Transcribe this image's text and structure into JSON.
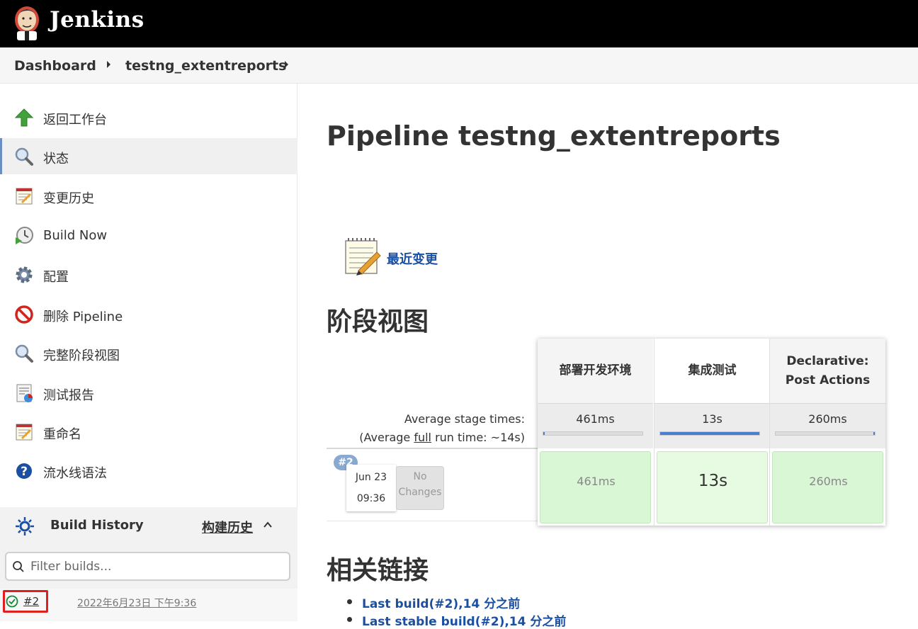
{
  "header": {
    "logo_text": "Jenkins"
  },
  "breadcrumb": {
    "items": [
      "Dashboard",
      "testng_extentreports"
    ]
  },
  "sidebar": {
    "items": [
      {
        "label": "返回工作台",
        "icon": "up-arrow-icon"
      },
      {
        "label": "状态",
        "icon": "search-icon",
        "active": true
      },
      {
        "label": "变更历史",
        "icon": "notepad-icon"
      },
      {
        "label": "Build Now",
        "icon": "clock-play-icon"
      },
      {
        "label": "配置",
        "icon": "gear-icon"
      },
      {
        "label": "删除 Pipeline",
        "icon": "no-entry-icon"
      },
      {
        "label": "完整阶段视图",
        "icon": "search-icon"
      },
      {
        "label": "测试报告",
        "icon": "report-icon"
      },
      {
        "label": "重命名",
        "icon": "notepad-icon"
      },
      {
        "label": "流水线语法",
        "icon": "help-icon"
      }
    ],
    "build_history": {
      "title": "Build History",
      "link": "构建历史",
      "filter_placeholder": "Filter builds...",
      "builds": [
        {
          "number": "#2",
          "date": "2022年6月23日 下午9:36",
          "status": "success"
        }
      ]
    }
  },
  "main": {
    "title": "Pipeline testng_extentreports",
    "recent_changes": "最近变更",
    "stage_view_heading": "阶段视图",
    "stage_view": {
      "avg_label": "Average stage times:",
      "avg_run_prefix": "(Average ",
      "avg_run_full": "full",
      "avg_run_suffix": " run time: ~14s)",
      "stages": [
        {
          "name_l1": "部署开发环境",
          "name_l2": "",
          "avg": "461ms",
          "bar_fraction": 0.0
        },
        {
          "name_l1": "集成测试",
          "name_l2": "",
          "avg": "13s",
          "bar_fraction": 1.0
        },
        {
          "name_l1": "Declarative:",
          "name_l2": "Post Actions",
          "avg": "260ms",
          "bar_fraction": 0.0
        }
      ],
      "run": {
        "badge": "#2",
        "date": "Jun 23",
        "time": "09:36",
        "no_changes_l1": "No",
        "no_changes_l2": "Changes",
        "cells": [
          "461ms",
          "13s",
          "260ms"
        ]
      }
    },
    "related_heading": "相关链接",
    "related_links": [
      {
        "text": "Last build(#2),14 分之前"
      },
      {
        "text": "Last stable build(#2),14 分之前"
      }
    ]
  }
}
